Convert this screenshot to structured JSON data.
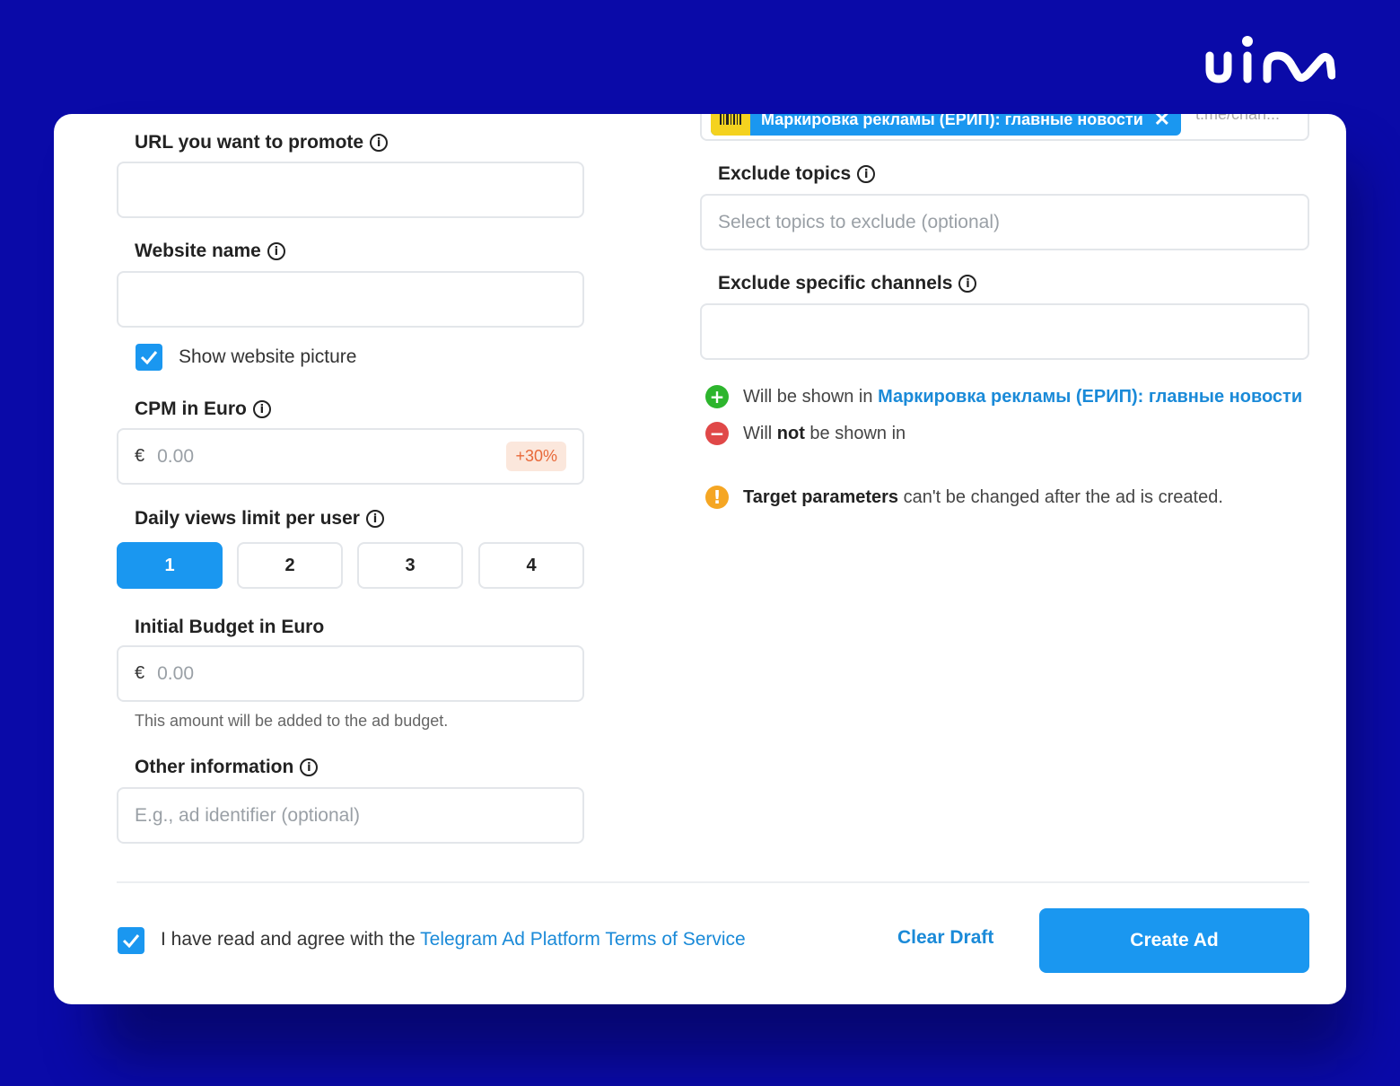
{
  "brand": {
    "logo_text": "uin"
  },
  "form": {
    "url": {
      "label": "URL you want to promote",
      "value": "",
      "placeholder": ""
    },
    "website_name": {
      "label": "Website name",
      "value": "",
      "placeholder": ""
    },
    "show_picture": {
      "label": "Show website picture",
      "checked": true
    },
    "cpm": {
      "label": "CPM in Euro",
      "currency": "€",
      "placeholder": "0.00",
      "badge": "+30%"
    },
    "daily_views": {
      "label": "Daily views limit per user",
      "options": [
        "1",
        "2",
        "3",
        "4"
      ],
      "selected": "1"
    },
    "budget": {
      "label": "Initial Budget in Euro",
      "currency": "€",
      "placeholder": "0.00",
      "hint": "This amount will be added to the ad budget."
    },
    "other_info": {
      "label": "Other information",
      "placeholder": "E.g., ad identifier (optional)"
    }
  },
  "targeting": {
    "channel_chip": {
      "label": "Маркировка рекламы (ЕРИП): главные новости",
      "close": "✕"
    },
    "channel_input_placeholder": "t.me/chan...",
    "exclude_topics": {
      "label": "Exclude topics",
      "placeholder": "Select topics to exclude (optional)"
    },
    "exclude_channels": {
      "label": "Exclude specific channels",
      "placeholder": ""
    },
    "shown_in": {
      "prefix": "Will be shown in ",
      "channel": "Маркировка рекламы (ЕРИП): главные новости"
    },
    "not_shown_in": {
      "prefix": "Will ",
      "bold": "not",
      "suffix": " be shown in"
    },
    "warning": {
      "bold": "Target parameters",
      "rest": " can't be changed after the ad is created."
    }
  },
  "footer": {
    "terms_prefix": "I have read and agree with the ",
    "terms_link": "Telegram Ad Platform Terms of Service",
    "terms_checked": true,
    "clear_draft": "Clear Draft",
    "create_ad": "Create Ad"
  },
  "colors": {
    "background": "#0a0aa8",
    "accent": "#1a97f0",
    "success": "#2db52d",
    "danger": "#e04848",
    "warning": "#f5a623"
  }
}
